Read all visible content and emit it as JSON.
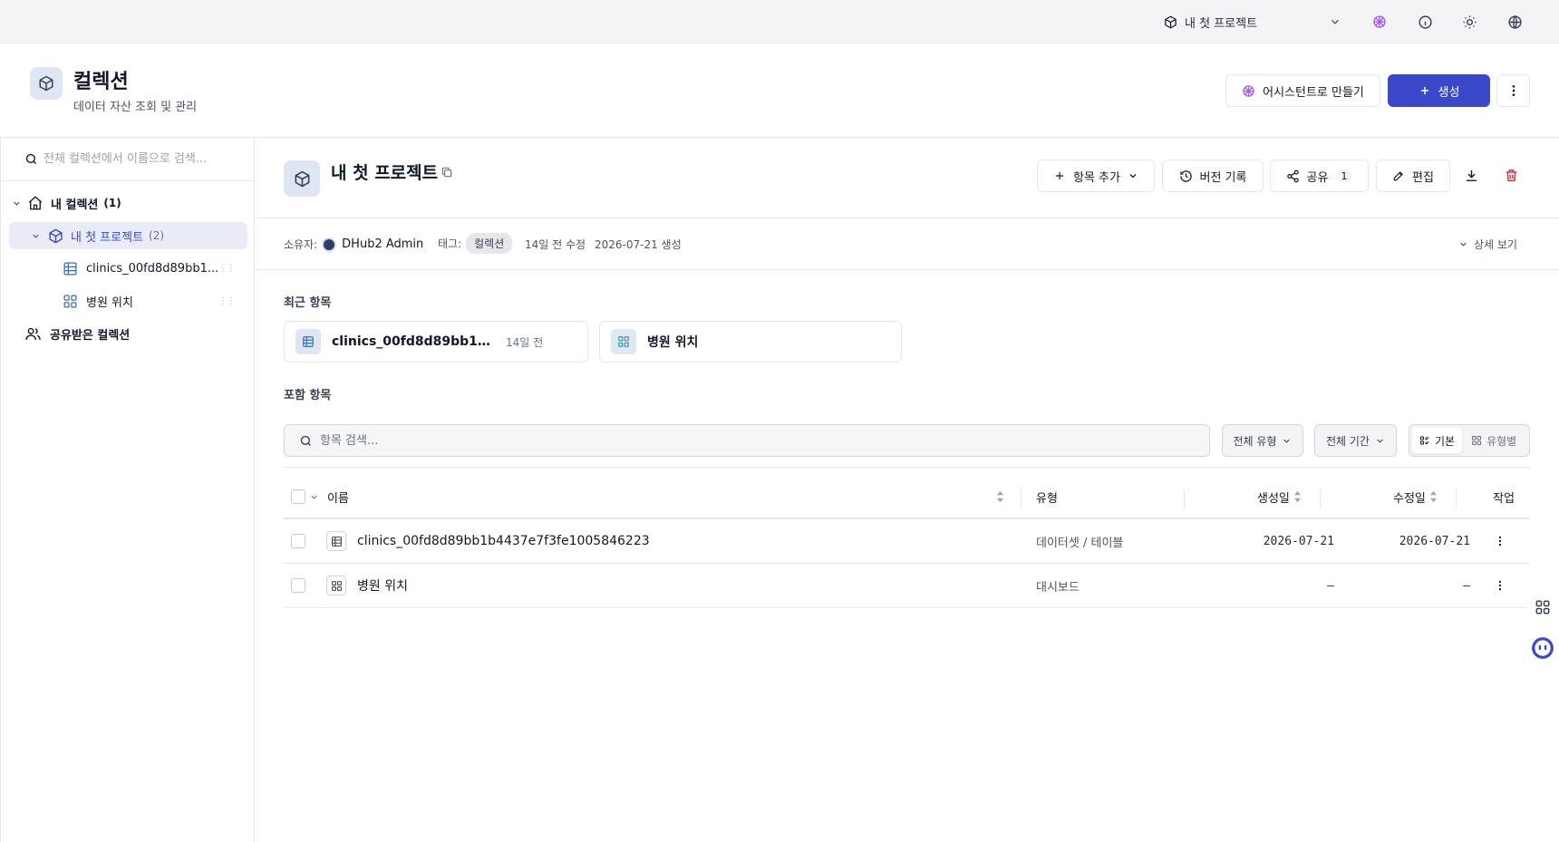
{
  "topbar": {
    "project_name": "내 첫 프로젝트"
  },
  "header": {
    "title": "컬렉션",
    "subtitle": "데이터 자산 조회 및 관리",
    "assistant_label": "어시스턴트로 만들기",
    "create_label": "생성"
  },
  "sidebar": {
    "search_placeholder": "전체 컬렉션에서 이름으로 검색...",
    "my_collections": {
      "label": "내 컬렉션",
      "count": "(1)"
    },
    "project": {
      "label": "내 첫 프로젝트",
      "count": "(2)"
    },
    "children": [
      {
        "label": "clinics_00fd8d89bb1...",
        "icon": "table-icon"
      },
      {
        "label": "병원 위치",
        "icon": "dashboard-icon"
      }
    ],
    "shared_label": "공유받은 컬렉션"
  },
  "collection": {
    "title": "내 첫 프로젝트",
    "add_item_label": "항목 추가",
    "history_label": "버전 기록",
    "share_label": "공유",
    "share_count": "1",
    "edit_label": "편집"
  },
  "meta": {
    "owner_label": "소유자:",
    "owner_name": "DHub2 Admin",
    "tags_label": "태그:",
    "tag": "컬렉션",
    "modified": "14일 전 수정",
    "created": "2026-07-21 생성",
    "details_label": "상세 보기"
  },
  "recent": {
    "title": "최근 항목",
    "items": [
      {
        "name": "clinics_00fd8d89bb1b44...",
        "time": "14일 전",
        "icon": "table-icon"
      },
      {
        "name": "병원 위치",
        "time": "",
        "icon": "dashboard-icon"
      }
    ]
  },
  "contents": {
    "title": "포함 항목",
    "search_placeholder": "항목 검색...",
    "type_filter": "전체 유형",
    "period_filter": "전체 기간",
    "view_basic": "기본",
    "view_by_type": "유형별",
    "columns": {
      "name": "이름",
      "type": "유형",
      "created": "생성일",
      "modified": "수정일",
      "actions": "작업"
    },
    "rows": [
      {
        "name": "clinics_00fd8d89bb1b4437e7f3fe1005846223",
        "type": "데이터셋 / 테이블",
        "created": "2026-07-21",
        "modified": "2026-07-21",
        "icon": "table-icon"
      },
      {
        "name": "병원 위치",
        "type": "대시보드",
        "created": "—",
        "modified": "—",
        "icon": "dashboard-icon"
      }
    ]
  },
  "colors": {
    "accent": "#3b48c9",
    "assistant": "#a855f7",
    "danger": "#dc2626",
    "active_bg": "#e9ecf7"
  }
}
